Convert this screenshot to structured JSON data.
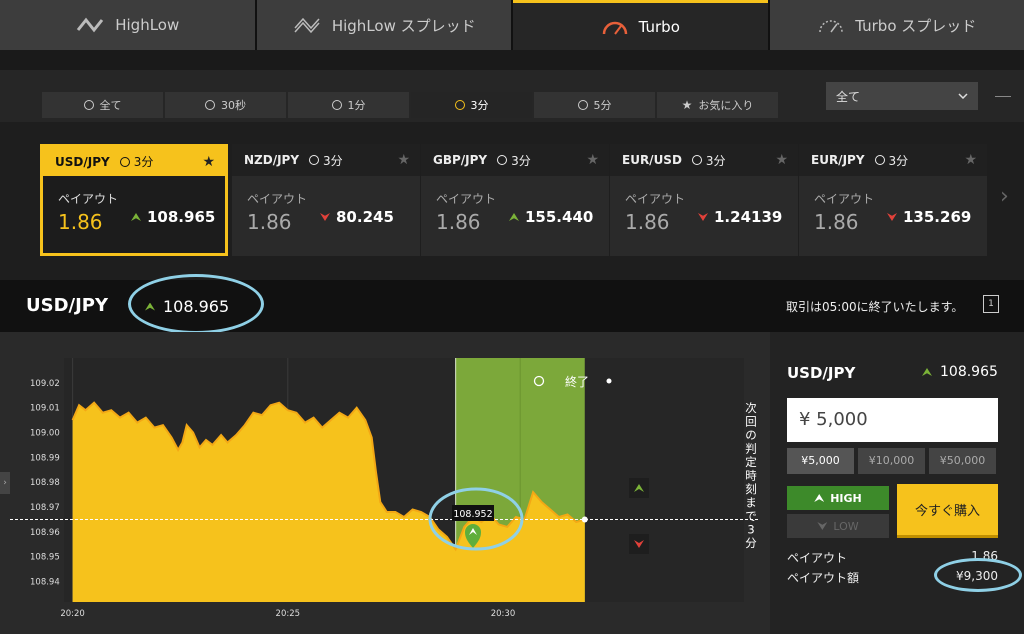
{
  "top_tabs": [
    {
      "label": "HighLow",
      "icon": "highlow-logo-icon",
      "active": false
    },
    {
      "label": "HighLow スプレッド",
      "icon": "highlow-spread-logo-icon",
      "active": false
    },
    {
      "label": "Turbo",
      "icon": "turbo-gauge-icon",
      "active": true
    },
    {
      "label": "Turbo スプレッド",
      "icon": "turbo-spread-gauge-icon",
      "active": false
    }
  ],
  "time_tabs": [
    {
      "label": "全て",
      "icon": "clock-icon",
      "active": false
    },
    {
      "label": "30秒",
      "icon": "clock-icon",
      "active": false
    },
    {
      "label": "1分",
      "icon": "clock-icon",
      "active": false
    },
    {
      "label": "3分",
      "icon": "clock-icon",
      "active": true
    },
    {
      "label": "5分",
      "icon": "clock-icon",
      "active": false
    },
    {
      "label": "お気に入り",
      "icon": "star-icon",
      "active": false
    }
  ],
  "filter_select": {
    "value": "全て"
  },
  "cards": [
    {
      "pair": "USD/JPY",
      "duration": "3分",
      "payout_label": "ペイアウト",
      "payout": "1.86",
      "rate": "108.965",
      "direction": "up",
      "active": true
    },
    {
      "pair": "NZD/JPY",
      "duration": "3分",
      "payout_label": "ペイアウト",
      "payout": "1.86",
      "rate": "80.245",
      "direction": "down",
      "active": false
    },
    {
      "pair": "GBP/JPY",
      "duration": "3分",
      "payout_label": "ペイアウト",
      "payout": "1.86",
      "rate": "155.440",
      "direction": "up",
      "active": false
    },
    {
      "pair": "EUR/USD",
      "duration": "3分",
      "payout_label": "ペイアウト",
      "payout": "1.86",
      "rate": "1.24139",
      "direction": "down",
      "active": false
    },
    {
      "pair": "EUR/JPY",
      "duration": "3分",
      "payout_label": "ペイアウト",
      "payout": "1.86",
      "rate": "135.269",
      "direction": "down",
      "active": false
    }
  ],
  "asset": {
    "name": "USD/JPY",
    "rate": "108.965",
    "close_message": "取引は05:00に終了いたします。",
    "expand_label": "1"
  },
  "chart": {
    "end_label": "終了",
    "next_judgement": "次回の判定時刻まで3分",
    "entry_marker_label": "108.952",
    "accent": "#f6c21c",
    "zone_color": "#7ca83a"
  },
  "chart_data": {
    "type": "area",
    "title": "",
    "xlabel": "",
    "ylabel": "",
    "ylim": [
      108.935,
      109.03
    ],
    "yticks": [
      109.02,
      109.01,
      109.0,
      108.99,
      108.98,
      108.97,
      108.96,
      108.95,
      108.94
    ],
    "ytick_labels": [
      "109.02",
      "109.01",
      "109.00",
      "108.99",
      "108.98",
      "108.97",
      "108.96",
      "108.95",
      "108.94"
    ],
    "xticks": [
      0,
      5,
      10
    ],
    "xtick_labels": [
      "20:20",
      "20:25",
      "20:30"
    ],
    "xlim": [
      -0.2,
      15.6
    ],
    "current_level": 108.965,
    "entry_point": {
      "x": 8.9,
      "y": 108.952
    },
    "expiry_window": [
      8.9,
      11.9
    ],
    "series": [
      {
        "x": [
          0,
          0.15,
          0.3,
          0.5,
          0.7,
          0.9,
          1.1,
          1.3,
          1.5,
          1.7,
          1.9,
          2.1,
          2.3,
          2.45,
          2.55,
          2.65,
          2.8,
          2.95,
          3.1,
          3.25,
          3.45,
          3.6,
          3.8,
          4.0,
          4.2,
          4.4,
          4.6,
          4.8,
          5.0,
          5.2,
          5.4,
          5.6,
          5.8,
          6.0,
          6.2,
          6.4,
          6.6,
          6.8,
          6.95,
          7.05,
          7.15,
          7.3,
          7.5,
          7.7,
          7.9,
          8.1,
          8.3,
          8.5,
          8.7,
          8.9,
          9.1,
          9.3,
          9.5,
          9.7,
          9.9,
          10.1,
          10.3,
          10.5,
          10.7,
          10.9,
          11.1,
          11.3,
          11.5,
          11.7,
          11.9
        ],
        "y": [
          109.005,
          109.011,
          109.009,
          109.012,
          109.008,
          109.009,
          109.006,
          109.008,
          109.004,
          109.006,
          109.002,
          109.003,
          108.998,
          108.993,
          108.996,
          109.003,
          109.0,
          108.994,
          108.997,
          108.995,
          108.999,
          108.996,
          108.999,
          109.003,
          109.008,
          109.007,
          109.011,
          109.012,
          109.009,
          109.008,
          109.004,
          109.006,
          109.002,
          109.005,
          109.008,
          109.006,
          109.01,
          109.005,
          108.998,
          108.984,
          108.972,
          108.968,
          108.968,
          108.966,
          108.969,
          108.968,
          108.966,
          108.961,
          108.958,
          108.953,
          108.962,
          108.966,
          108.964,
          108.967,
          108.963,
          108.962,
          108.966,
          108.965,
          108.976,
          108.972,
          108.969,
          108.966,
          108.967,
          108.964,
          108.965
        ]
      }
    ]
  },
  "trade": {
    "pair": "USD/JPY",
    "rate": "108.965",
    "amount": "¥ 5,000",
    "amount_options": [
      "¥5,000",
      "¥10,000",
      "¥50,000"
    ],
    "high_label": "HIGH",
    "low_label": "LOW",
    "buy_label": "今すぐ購入",
    "payout_label": "ペイアウト",
    "payout_value": "1.86",
    "payout_amount_label": "ペイアウト額",
    "payout_amount": "¥9,300"
  }
}
